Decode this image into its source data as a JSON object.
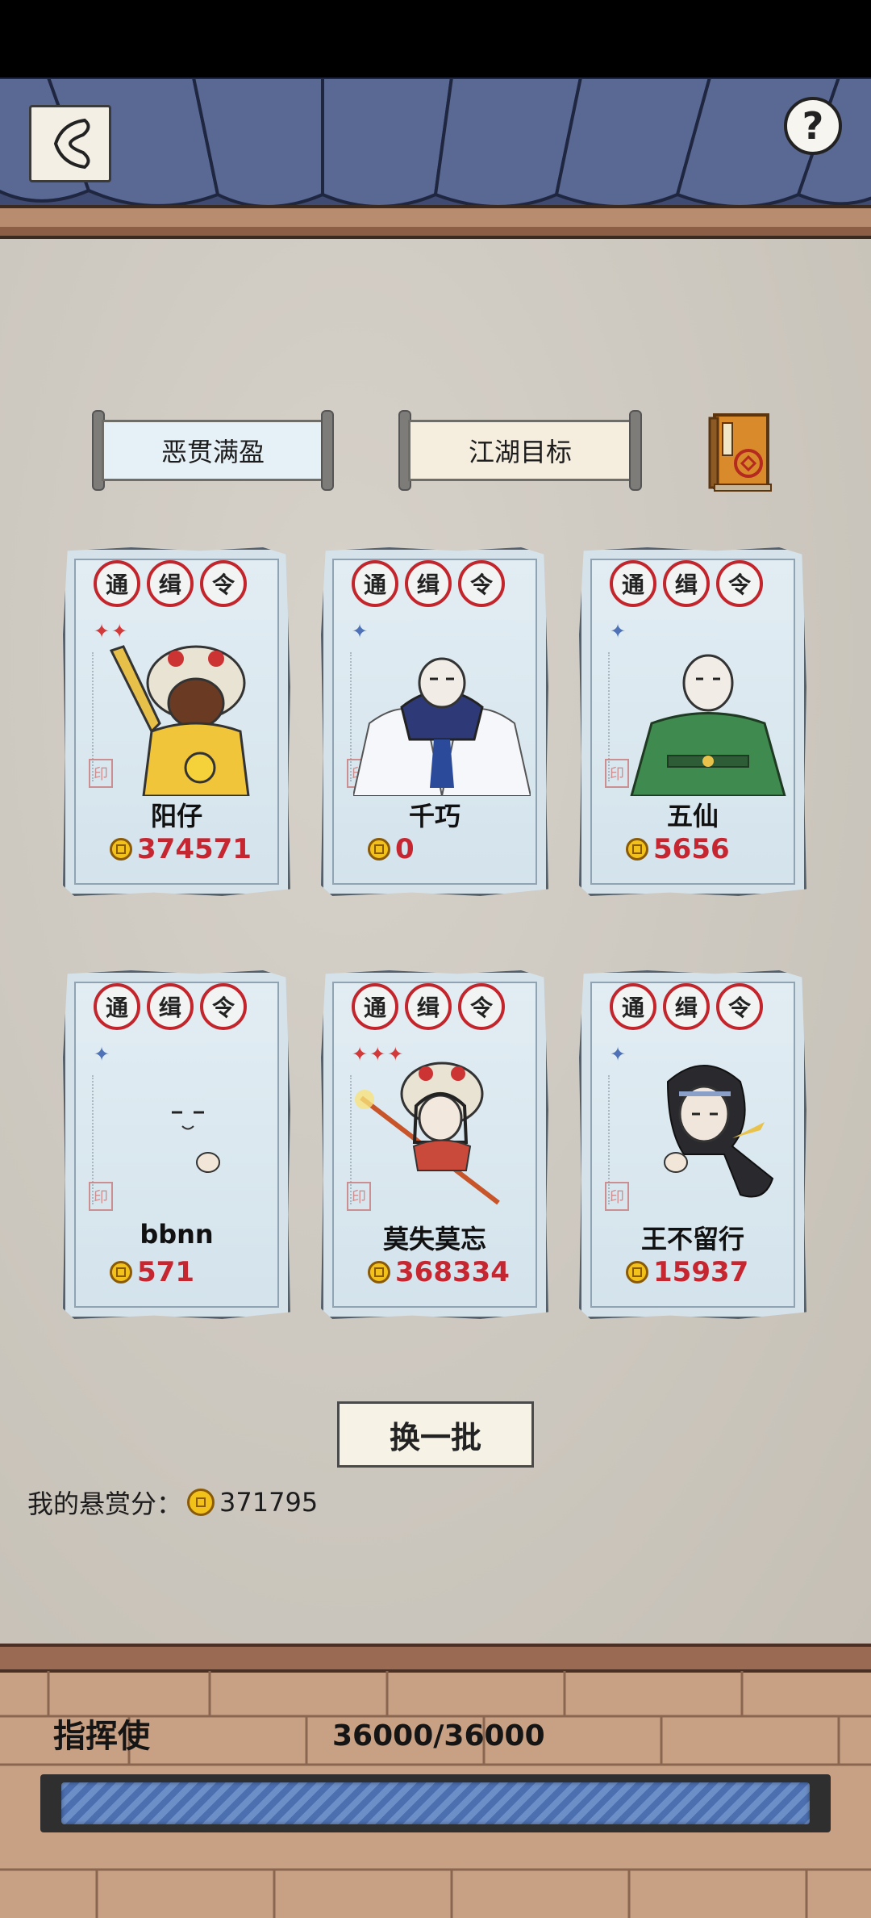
{
  "header": {
    "back_icon": "back-arrow-icon",
    "help_label": "?"
  },
  "tabs": [
    {
      "label": "恶贯满盈"
    },
    {
      "label": "江湖目标"
    }
  ],
  "book_icon": "wanted-book-icon",
  "cards": [
    {
      "name": "阳仔",
      "score": "374571",
      "stars": 2,
      "star_color": "red",
      "badges": [
        "通",
        "缉",
        "令"
      ]
    },
    {
      "name": "千巧",
      "score": "0",
      "stars": 1,
      "star_color": "blue",
      "badges": [
        "通",
        "缉",
        "令"
      ]
    },
    {
      "name": "五仙",
      "score": "5656",
      "stars": 1,
      "star_color": "blue",
      "badges": [
        "通",
        "缉",
        "令"
      ]
    },
    {
      "name": "bbnn",
      "score": "571",
      "stars": 1,
      "star_color": "blue",
      "badges": [
        "通",
        "缉",
        "令"
      ]
    },
    {
      "name": "莫失莫忘",
      "score": "368334",
      "stars": 3,
      "star_color": "red",
      "badges": [
        "通",
        "缉",
        "令"
      ]
    },
    {
      "name": "王不留行",
      "score": "15937",
      "stars": 1,
      "star_color": "blue",
      "badges": [
        "通",
        "缉",
        "令"
      ]
    }
  ],
  "refresh_label": "换一批",
  "my_score": {
    "label": "我的悬赏分：",
    "value": "371795"
  },
  "rank": {
    "title": "指挥使",
    "progress_text": "36000/36000",
    "progress_fraction": 1.0
  },
  "colors": {
    "awning": "#46527a",
    "seal_red": "#c2262c",
    "score_red": "#c52630",
    "progress_blue": "#4c6fb0"
  }
}
